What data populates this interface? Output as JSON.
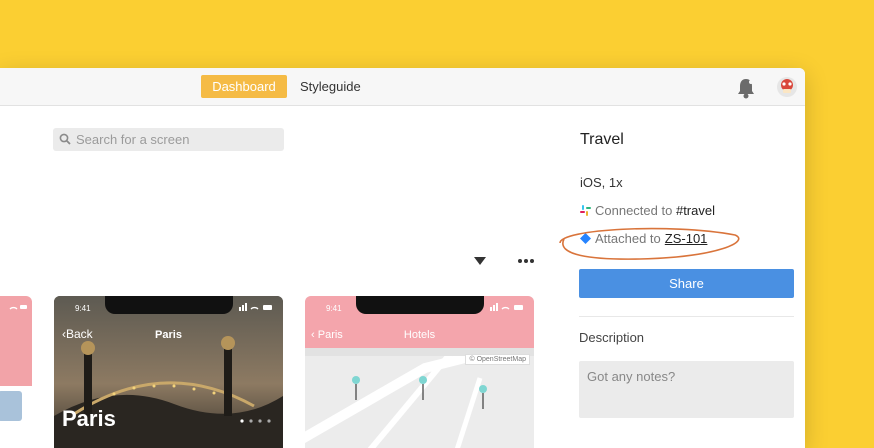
{
  "topbar": {
    "tabs": [
      {
        "label": "Dashboard",
        "active": true
      },
      {
        "label": "Styleguide",
        "active": false
      }
    ]
  },
  "search": {
    "placeholder": "Search for a screen"
  },
  "cards": [
    {
      "status_time": "9:41",
      "back_label": "Back",
      "title": "Paris",
      "hero_title": "Paris"
    },
    {
      "status_time": "9:41",
      "back_label": "Paris",
      "title": "Hotels",
      "map_attribution": "© OpenStreetMap"
    }
  ],
  "sidebar": {
    "title": "Travel",
    "platform": "iOS, 1x",
    "connected_prefix": "Connected to",
    "connected_channel": "#travel",
    "attached_prefix": "Attached to",
    "attached_issue": "ZS-101",
    "share_label": "Share",
    "description_label": "Description",
    "notes_placeholder": "Got any notes?"
  },
  "colors": {
    "background": "#fbcf32",
    "accent_tab": "#f5bb45",
    "share_button": "#4a90e2",
    "card_header_pink": "#f4a5ac",
    "annotation_ellipse": "#d9743b"
  },
  "icons": [
    "bell-icon",
    "avatar",
    "search-icon",
    "filter-icon",
    "more-icon",
    "slack-icon",
    "jira-icon"
  ]
}
